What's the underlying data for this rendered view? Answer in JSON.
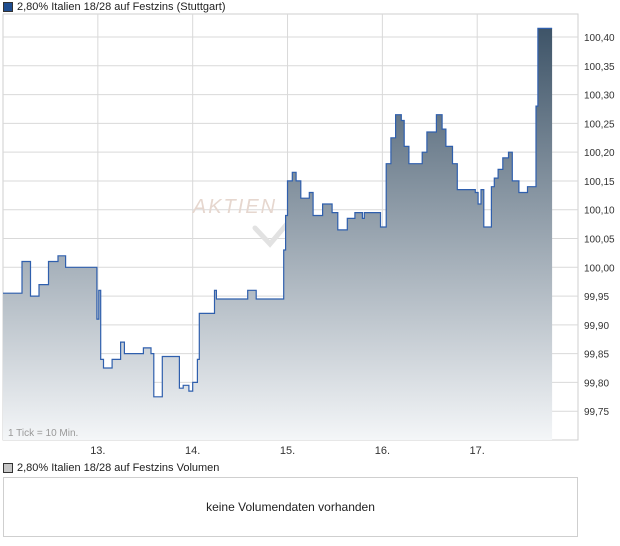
{
  "legend": {
    "price_label": "2,80% Italien 18/28 auf Festzins (Stuttgart)",
    "volume_label": "2,80% Italien 18/28 auf Festzins Volumen"
  },
  "tick_note": "1 Tick = 10 Min.",
  "watermark": "AKTIEN",
  "volume_message": "keine Volumendaten vorhanden",
  "colors": {
    "line": "#2f5fad",
    "fill_top": "#3e5468",
    "fill_bottom": "#f4f6f8",
    "grid": "#d9d9d9",
    "axis_text": "#333333"
  },
  "chart_data": {
    "type": "area",
    "x_tick_labels": [
      "13.",
      "14.",
      "15.",
      "16.",
      "17."
    ],
    "y_tick_labels": [
      "99,75",
      "99,80",
      "99,85",
      "99,90",
      "99,95",
      "100,00",
      "100,05",
      "100,10",
      "100,15",
      "100,20",
      "100,25",
      "100,30",
      "100,35",
      "100,40"
    ],
    "ylim": [
      99.7,
      100.44
    ],
    "xlim": [
      0,
      5.0
    ],
    "grid": true,
    "series": [
      {
        "points": [
          [
            0.0,
            99.955
          ],
          [
            0.2,
            99.955
          ],
          [
            0.2,
            100.01
          ],
          [
            0.29,
            100.01
          ],
          [
            0.29,
            99.95
          ],
          [
            0.38,
            99.95
          ],
          [
            0.38,
            99.97
          ],
          [
            0.48,
            99.97
          ],
          [
            0.48,
            100.01
          ],
          [
            0.58,
            100.01
          ],
          [
            0.58,
            100.02
          ],
          [
            0.66,
            100.02
          ],
          [
            0.66,
            100.0
          ],
          [
            0.99,
            100.0
          ],
          [
            0.99,
            99.91
          ],
          [
            1.01,
            99.91
          ],
          [
            1.01,
            99.96
          ],
          [
            1.03,
            99.96
          ],
          [
            1.03,
            99.84
          ],
          [
            1.06,
            99.84
          ],
          [
            1.06,
            99.825
          ],
          [
            1.15,
            99.825
          ],
          [
            1.15,
            99.84
          ],
          [
            1.24,
            99.84
          ],
          [
            1.24,
            99.87
          ],
          [
            1.28,
            99.87
          ],
          [
            1.28,
            99.85
          ],
          [
            1.48,
            99.85
          ],
          [
            1.48,
            99.86
          ],
          [
            1.56,
            99.86
          ],
          [
            1.56,
            99.85
          ],
          [
            1.59,
            99.85
          ],
          [
            1.59,
            99.775
          ],
          [
            1.68,
            99.775
          ],
          [
            1.68,
            99.845
          ],
          [
            1.86,
            99.845
          ],
          [
            1.86,
            99.79
          ],
          [
            1.9,
            99.79
          ],
          [
            1.9,
            99.795
          ],
          [
            1.96,
            99.795
          ],
          [
            1.96,
            99.785
          ],
          [
            2.0,
            99.785
          ],
          [
            2.0,
            99.8
          ],
          [
            2.05,
            99.8
          ],
          [
            2.05,
            99.84
          ],
          [
            2.07,
            99.84
          ],
          [
            2.07,
            99.92
          ],
          [
            2.23,
            99.92
          ],
          [
            2.23,
            99.96
          ],
          [
            2.25,
            99.96
          ],
          [
            2.25,
            99.945
          ],
          [
            2.58,
            99.945
          ],
          [
            2.58,
            99.96
          ],
          [
            2.67,
            99.96
          ],
          [
            2.67,
            99.945
          ],
          [
            2.96,
            99.945
          ],
          [
            2.96,
            100.03
          ],
          [
            2.98,
            100.03
          ],
          [
            2.98,
            100.09
          ],
          [
            3.0,
            100.09
          ],
          [
            3.0,
            100.15
          ],
          [
            3.05,
            100.15
          ],
          [
            3.05,
            100.165
          ],
          [
            3.09,
            100.165
          ],
          [
            3.09,
            100.15
          ],
          [
            3.14,
            100.15
          ],
          [
            3.14,
            100.12
          ],
          [
            3.23,
            100.12
          ],
          [
            3.23,
            100.13
          ],
          [
            3.27,
            100.13
          ],
          [
            3.27,
            100.09
          ],
          [
            3.37,
            100.09
          ],
          [
            3.37,
            100.11
          ],
          [
            3.47,
            100.11
          ],
          [
            3.47,
            100.095
          ],
          [
            3.53,
            100.095
          ],
          [
            3.53,
            100.065
          ],
          [
            3.63,
            100.065
          ],
          [
            3.63,
            100.085
          ],
          [
            3.71,
            100.085
          ],
          [
            3.71,
            100.095
          ],
          [
            3.79,
            100.095
          ],
          [
            3.79,
            100.085
          ],
          [
            3.81,
            100.085
          ],
          [
            3.81,
            100.095
          ],
          [
            3.98,
            100.095
          ],
          [
            3.98,
            100.07
          ],
          [
            4.04,
            100.07
          ],
          [
            4.04,
            100.18
          ],
          [
            4.09,
            100.18
          ],
          [
            4.09,
            100.225
          ],
          [
            4.14,
            100.225
          ],
          [
            4.14,
            100.265
          ],
          [
            4.2,
            100.265
          ],
          [
            4.2,
            100.255
          ],
          [
            4.23,
            100.255
          ],
          [
            4.23,
            100.21
          ],
          [
            4.28,
            100.21
          ],
          [
            4.28,
            100.18
          ],
          [
            4.42,
            100.18
          ],
          [
            4.42,
            100.2
          ],
          [
            4.47,
            100.2
          ],
          [
            4.47,
            100.235
          ],
          [
            4.57,
            100.235
          ],
          [
            4.57,
            100.265
          ],
          [
            4.63,
            100.265
          ],
          [
            4.63,
            100.24
          ],
          [
            4.67,
            100.24
          ],
          [
            4.67,
            100.21
          ],
          [
            4.74,
            100.21
          ],
          [
            4.74,
            100.18
          ],
          [
            4.79,
            100.18
          ],
          [
            4.79,
            100.135
          ],
          [
            4.98,
            100.135
          ],
          [
            4.98,
            100.13
          ],
          [
            5.01,
            100.13
          ],
          [
            5.01,
            100.11
          ],
          [
            5.04,
            100.11
          ],
          [
            5.04,
            100.135
          ],
          [
            5.07,
            100.135
          ],
          [
            5.07,
            100.07
          ],
          [
            5.15,
            100.07
          ],
          [
            5.15,
            100.14
          ],
          [
            5.18,
            100.14
          ],
          [
            5.18,
            100.155
          ],
          [
            5.22,
            100.155
          ],
          [
            5.22,
            100.17
          ],
          [
            5.27,
            100.17
          ],
          [
            5.27,
            100.19
          ],
          [
            5.33,
            100.19
          ],
          [
            5.33,
            100.2
          ],
          [
            5.37,
            100.2
          ],
          [
            5.37,
            100.15
          ],
          [
            5.44,
            100.15
          ],
          [
            5.44,
            100.13
          ],
          [
            5.53,
            100.13
          ],
          [
            5.53,
            100.14
          ],
          [
            5.62,
            100.14
          ],
          [
            5.62,
            100.28
          ],
          [
            5.64,
            100.28
          ],
          [
            5.64,
            100.415
          ],
          [
            5.79,
            100.415
          ]
        ]
      }
    ]
  }
}
